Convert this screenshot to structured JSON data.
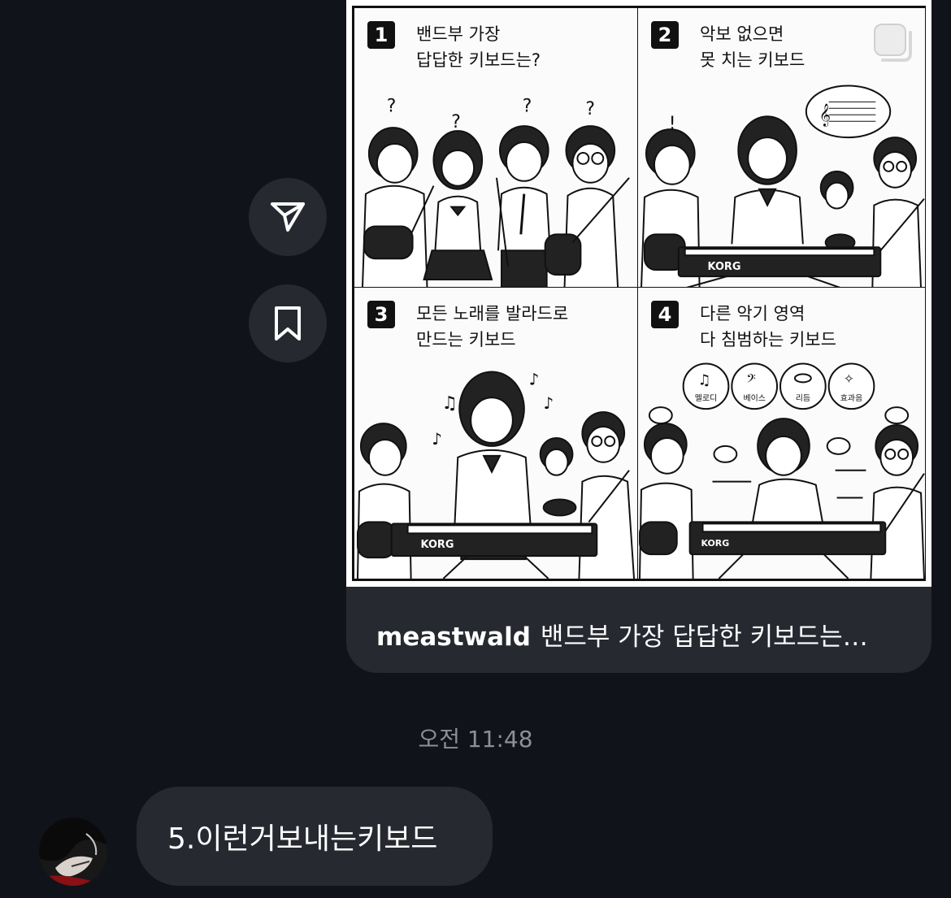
{
  "shared_post": {
    "username": "meastwald",
    "caption": "밴드부 가장 답답한 키보드는…",
    "panels": [
      {
        "number": "1",
        "caption": "밴드부 가장\n답답한 키보드는?"
      },
      {
        "number": "2",
        "caption": "악보 없으면\n못 치는 키보드"
      },
      {
        "number": "3",
        "caption": "모든 노래를 발라드로\n만드는 키보드"
      },
      {
        "number": "4",
        "caption": "다른 악기 영역\n다 침범하는 키보드"
      }
    ],
    "keyboard_brand": "KORG",
    "instrument_labels": [
      "멜로디",
      "베이스",
      "리듬",
      "효과음"
    ]
  },
  "actions": {
    "share_icon": "paper-plane-icon",
    "save_icon": "bookmark-icon"
  },
  "timestamp": "오전 11:48",
  "message": {
    "text": "5.이런거보내는키보드"
  },
  "colors": {
    "background": "#10131a",
    "bubble": "#262930",
    "timestamp": "#8c8f97"
  }
}
